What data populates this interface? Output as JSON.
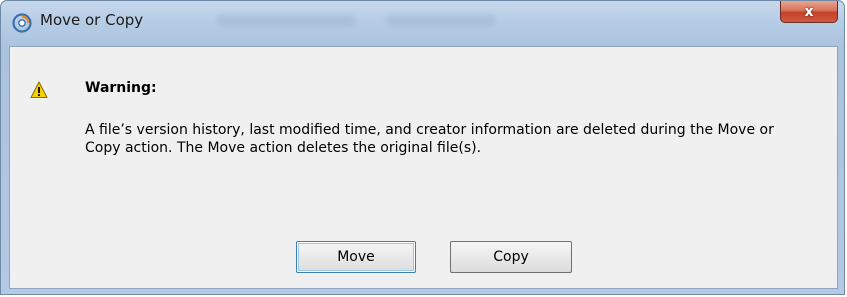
{
  "window": {
    "title": "Move or Copy",
    "close_label": "x"
  },
  "dialog": {
    "heading": "Warning:",
    "message": "A file’s version history, last modified time, and creator information are deleted during the Move or Copy action. The Move action deletes the original file(s).",
    "icon": "warning-icon"
  },
  "buttons": {
    "move_label": "Move",
    "copy_label": "Copy"
  },
  "colors": {
    "titlebar": "#b7cde6",
    "client_bg": "#f0f0f0",
    "close_red": "#c4402a",
    "warning_yellow": "#f5d000"
  }
}
